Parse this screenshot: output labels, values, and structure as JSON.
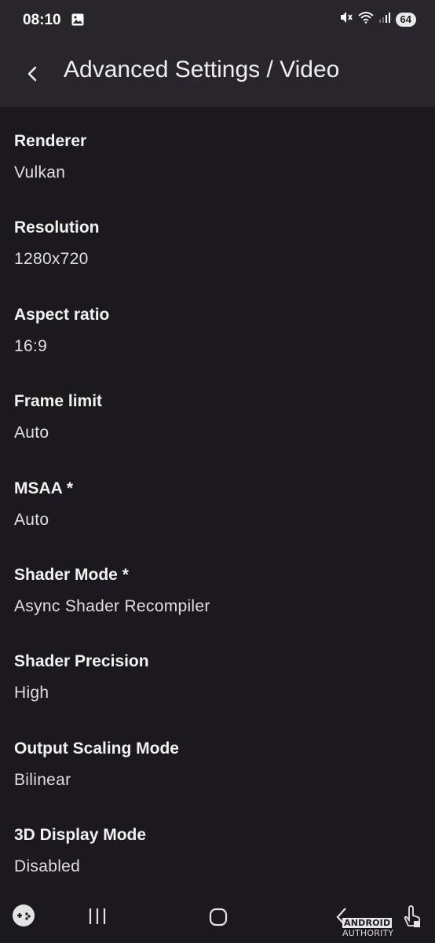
{
  "status_bar": {
    "time": "08:10",
    "battery": "64",
    "icons": [
      "gallery-icon",
      "mute-icon",
      "wifi-icon",
      "signal-icon"
    ]
  },
  "header": {
    "title": "Advanced Settings / Video",
    "back_icon": "back-arrow-icon"
  },
  "settings": [
    {
      "label": "Renderer",
      "value": "Vulkan"
    },
    {
      "label": "Resolution",
      "value": "1280x720"
    },
    {
      "label": "Aspect ratio",
      "value": "16:9"
    },
    {
      "label": "Frame limit",
      "value": "Auto"
    },
    {
      "label": "MSAA *",
      "value": "Auto"
    },
    {
      "label": "Shader Mode *",
      "value": "Async Shader Recompiler"
    },
    {
      "label": "Shader Precision",
      "value": "High"
    },
    {
      "label": "Output Scaling Mode",
      "value": "Bilinear"
    },
    {
      "label": "3D Display Mode",
      "value": "Disabled"
    }
  ],
  "nav_bar": {
    "icons": [
      "gamepad-icon",
      "recents-icon",
      "home-icon",
      "back-icon",
      "touch-icon"
    ]
  },
  "watermark": {
    "brand": "ANDROID",
    "suffix": "AUTHORITY"
  }
}
